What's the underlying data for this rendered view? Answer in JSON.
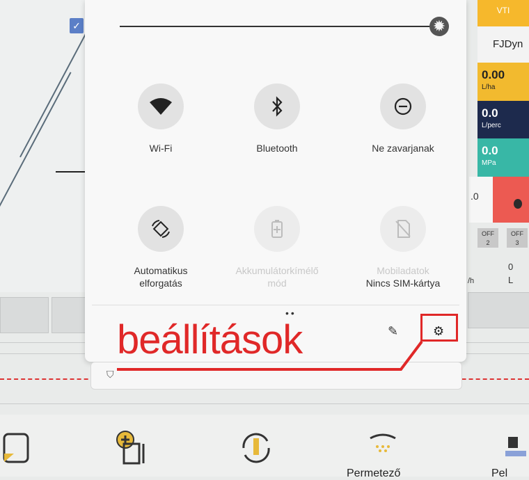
{
  "quick_settings": {
    "tiles": [
      {
        "label": "Wi-Fi",
        "icon": "wifi-icon",
        "enabled": true
      },
      {
        "label": "Bluetooth",
        "icon": "bluetooth-icon",
        "enabled": true
      },
      {
        "label": "Ne zavarjanak",
        "icon": "do-not-disturb-icon",
        "enabled": true
      },
      {
        "label": "Automatikus elforgatás",
        "icon": "auto-rotate-icon",
        "enabled": true
      },
      {
        "label": "Akkumulátorkímélő mód",
        "icon": "battery-saver-icon",
        "enabled": false
      },
      {
        "label": "Mobiladatok",
        "sublabel": "Nincs SIM-kártya",
        "icon": "no-sim-icon",
        "enabled": false
      }
    ],
    "footer": {
      "edit_icon": "pencil-icon",
      "settings_icon": "gear-icon"
    }
  },
  "annotation": {
    "text": "beállítások",
    "color": "#e02828"
  },
  "right_panel": {
    "vti": "VTI",
    "fjd": "FJDyn",
    "rate_value": "0.00",
    "rate_unit": "L/ha",
    "flow_value": "0.0",
    "flow_unit": "L/perc",
    "pressure_value": "0.0",
    "pressure_unit": "MPa",
    "small_value": ".0",
    "off1_label": "OFF",
    "off1_num": "2",
    "off2_label": "OFF",
    "off2_num": "3",
    "stat_value": "0",
    "stat_unit": "L",
    "vh_unit": "/h"
  },
  "bottom_bar": {
    "label_sprayer": "Permetező",
    "label_partial": "Pel"
  },
  "colors": {
    "vti": "#f6b82c",
    "rate": "#f2ba2f",
    "flow": "#1d2a4d",
    "pressure": "#38b7a6",
    "alarm": "#ec5a52"
  }
}
